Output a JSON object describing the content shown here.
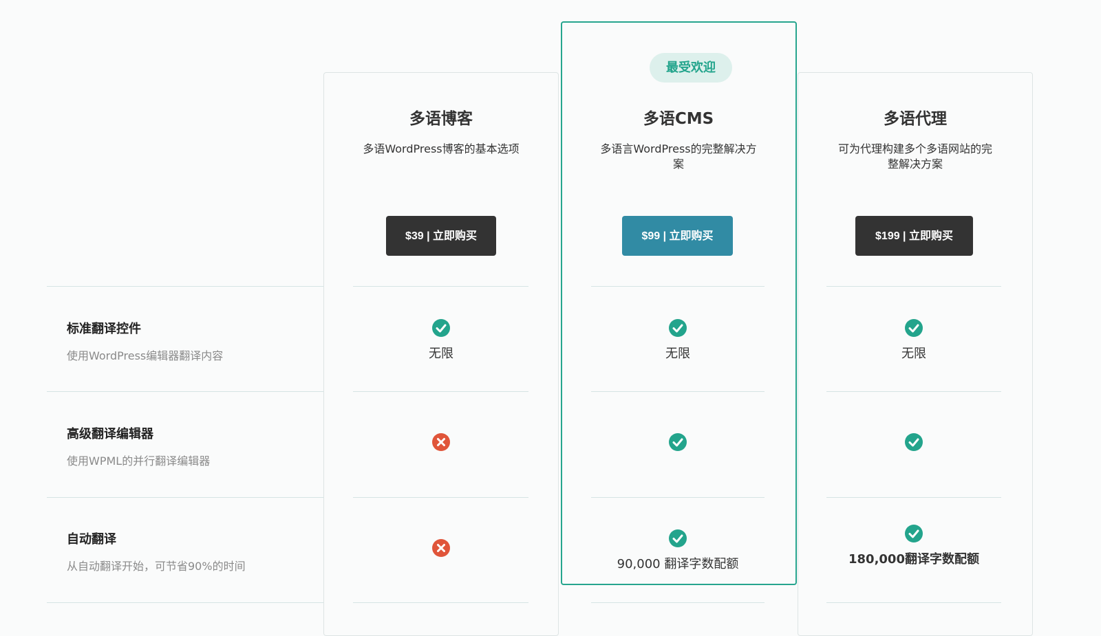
{
  "badge": "最受欢迎",
  "features": [
    {
      "title": "标准翻译控件",
      "desc": "使用WordPress编辑器翻译内容"
    },
    {
      "title": "高级翻译编辑器",
      "desc": "使用WPML的并行翻译编辑器"
    },
    {
      "title": "自动翻译",
      "desc": "从自动翻译开始，可节省90%的时间"
    }
  ],
  "plans": [
    {
      "name": "多语博客",
      "desc_lines": [
        "多语WordPress博客的基本选项"
      ],
      "button": "$39 | 立即购买",
      "rows": [
        {
          "included": true,
          "text": "无限"
        },
        {
          "included": false,
          "text": ""
        },
        {
          "included": false,
          "text": ""
        }
      ]
    },
    {
      "name": "多语CMS",
      "desc_lines": [
        "多语言WordPress的完整解决方",
        "案"
      ],
      "button": "$99 | 立即购买",
      "rows": [
        {
          "included": true,
          "text": "无限"
        },
        {
          "included": true,
          "text": ""
        },
        {
          "included": true,
          "text": "90,000 翻译字数配额"
        }
      ]
    },
    {
      "name": "多语代理",
      "desc_lines": [
        "可为代理构建多个多语网站的完",
        "整解决方案"
      ],
      "button": "$199 | 立即购买",
      "rows": [
        {
          "included": true,
          "text": "无限"
        },
        {
          "included": true,
          "text": ""
        },
        {
          "included": true,
          "text": "180,000翻译字数配额"
        }
      ]
    }
  ],
  "colors": {
    "check": "#23a48c",
    "cross": "#e0553a",
    "accent": "#26a58e",
    "button_dark": "#333333",
    "button_teal": "#318ba4"
  },
  "icons": {
    "included": "check-circle-icon",
    "excluded": "x-circle-icon"
  }
}
